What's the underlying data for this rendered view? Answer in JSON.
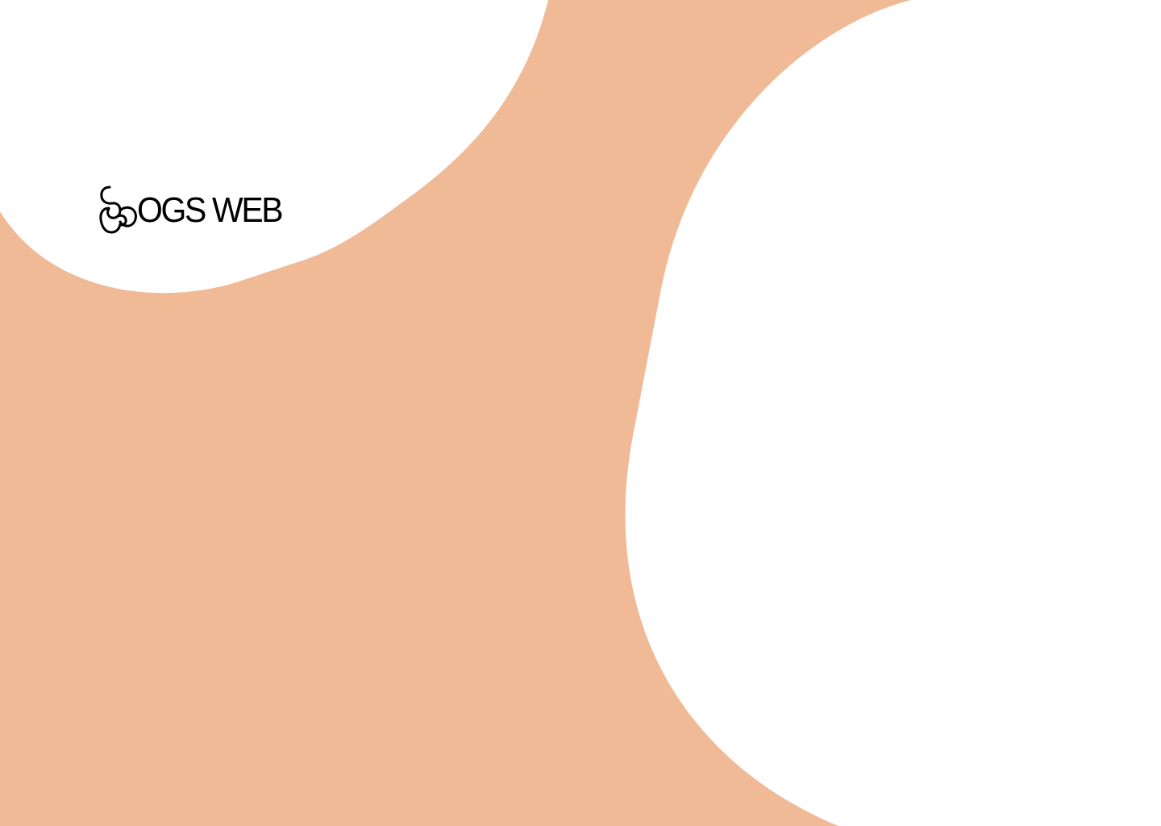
{
  "brand": {
    "name": "OGS WEB",
    "logo_icon": "paw-swirl-icon"
  },
  "colors": {
    "background": "#EFBA95",
    "shape": "#FFFFFF",
    "text": "#000000"
  }
}
